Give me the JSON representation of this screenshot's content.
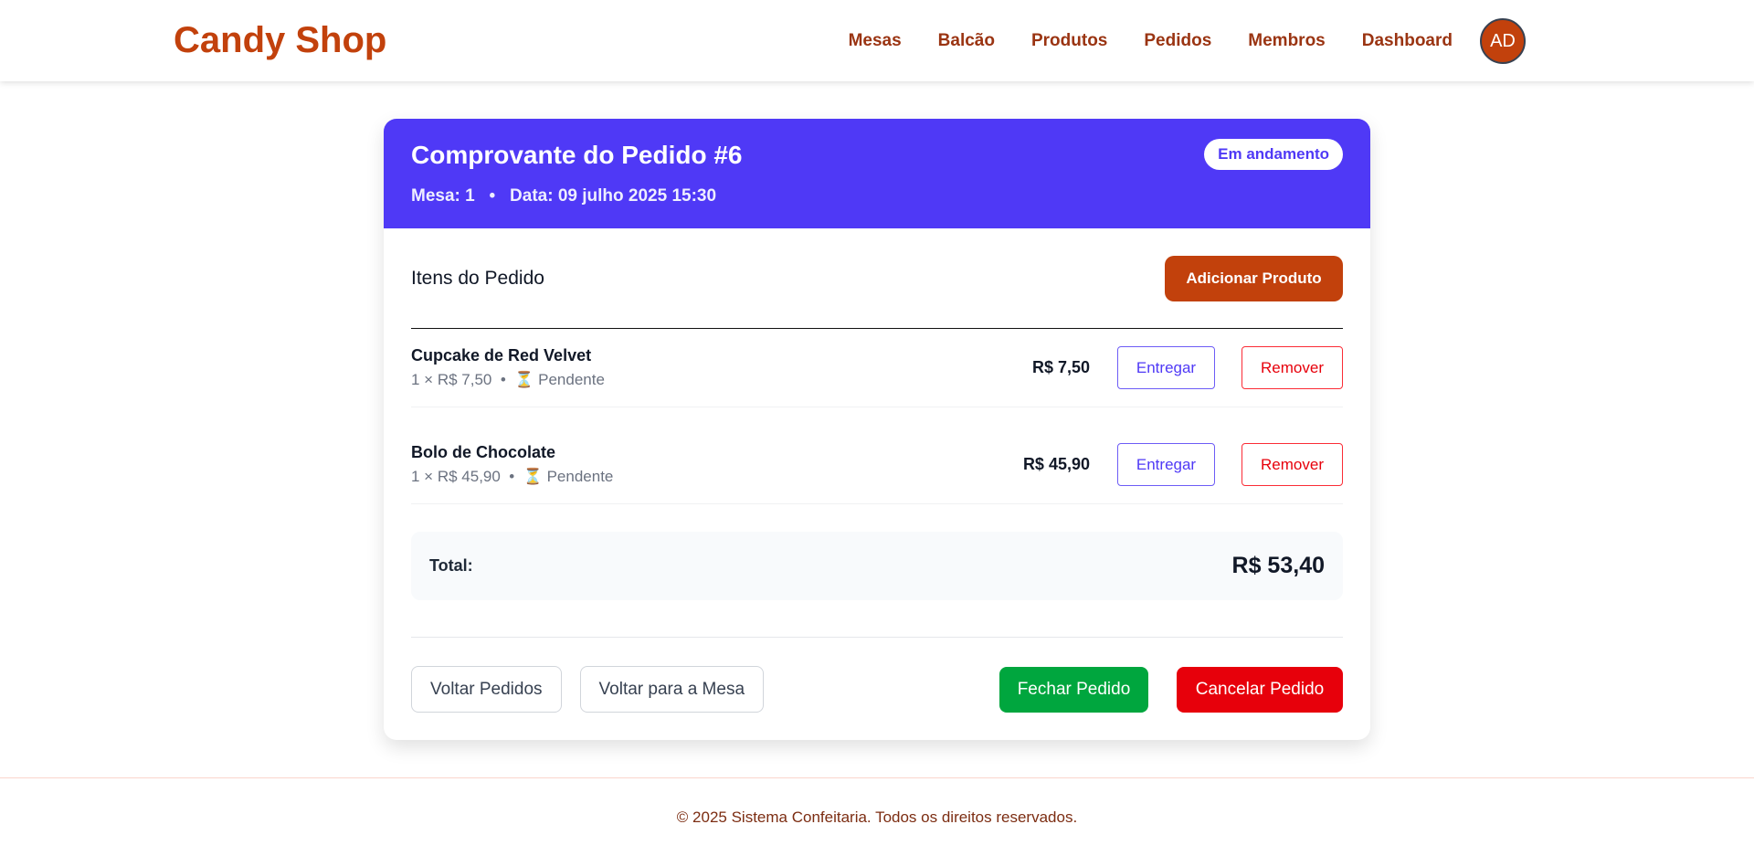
{
  "app": {
    "logo": "Candy Shop"
  },
  "nav": {
    "items": [
      "Mesas",
      "Balcão",
      "Produtos",
      "Pedidos",
      "Membros",
      "Dashboard"
    ],
    "avatar": "AD"
  },
  "order": {
    "title": "Comprovante do Pedido #6",
    "status": "Em andamento",
    "mesa": "Mesa: 1",
    "sep": "•",
    "data": "Data: 09 julho 2025 15:30"
  },
  "items_section": {
    "heading": "Itens do Pedido",
    "add_label": "Adicionar Produto"
  },
  "items": [
    {
      "name": "Cupcake de Red Velvet",
      "qty_price": "1 × R$ 7,50",
      "status_icon": "hourglass",
      "status": "Pendente",
      "total": "R$ 7,50",
      "deliver": "Entregar",
      "remove": "Remover"
    },
    {
      "name": "Bolo de Chocolate",
      "qty_price": "1 × R$ 45,90",
      "status_icon": "hourglass",
      "status": "Pendente",
      "total": "R$ 45,90",
      "deliver": "Entregar",
      "remove": "Remover"
    }
  ],
  "total": {
    "label": "Total:",
    "value": "R$ 53,40"
  },
  "actions": {
    "back_orders": "Voltar Pedidos",
    "back_table": "Voltar para a Mesa",
    "close": "Fechar Pedido",
    "cancel": "Cancelar Pedido"
  },
  "footer": {
    "text": "© 2025 Sistema Confeitaria. Todos os direitos reservados."
  },
  "colors": {
    "brand": "#c2410c",
    "header": "#4f39f6",
    "success": "#00a63e",
    "danger": "#e7000b"
  }
}
